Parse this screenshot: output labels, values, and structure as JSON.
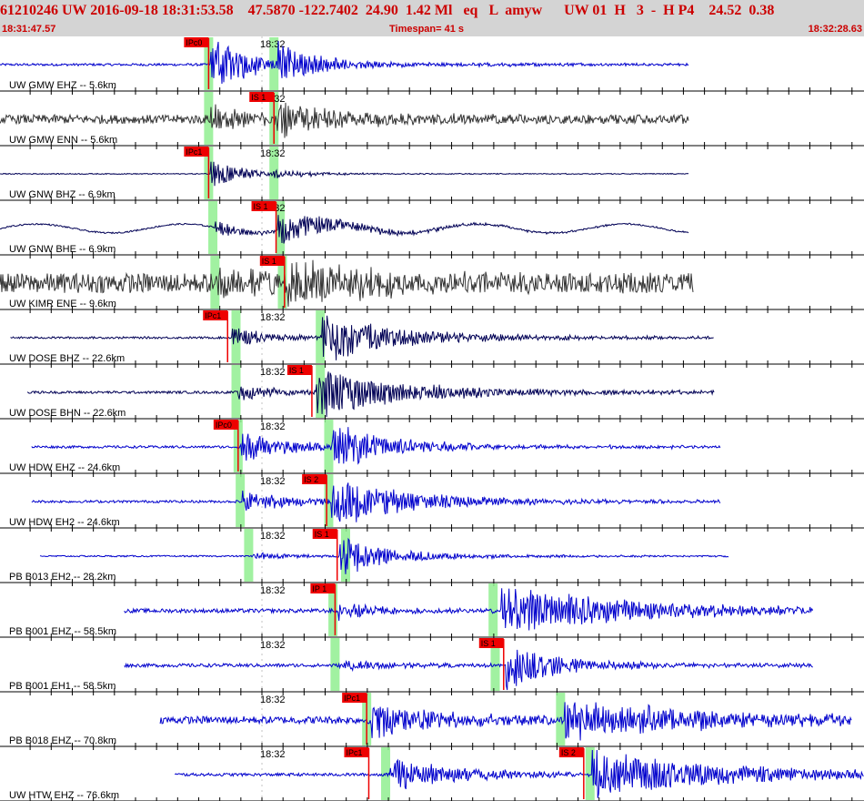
{
  "header": {
    "title": "61210246 UW 2016-09-18 18:31:53.58    47.5870 -122.7402  24.90  1.42 Ml   eq   L  amyw      UW 01  H   3  -  H P4    24.52  0.38",
    "start_time": "18:31:47.57",
    "timespan": "Timespan=  41 s",
    "end_time": "18:32:28.63"
  },
  "colors": {
    "grid": "#000000",
    "pick_box": "#ee0000",
    "pick_window": "#90ee90",
    "trace_blue": "#0000cc",
    "trace_dark": "#333333",
    "trace_navy": "#000055"
  },
  "chart_data": {
    "type": "line",
    "title": "61210246 UW 2016-09-18 18:31:53.58    47.5870 -122.7402  24.90  1.42 Ml   eq   L  amyw      UW 01  H   3  -  H P4    24.52  0.38",
    "x_start_time": "18:31:47.57",
    "x_end_time": "18:32:28.63",
    "timespan_s": 41,
    "minute_tick_label": "18:32",
    "minute_tick_offset_s": 12.43,
    "channels": [
      {
        "label": "UW GMW EHZ -- 5.6km",
        "color": "blue",
        "trace_start_s": 0.0,
        "trace_end_s": 32.7,
        "noise": 0.05,
        "picks": [
          {
            "label": "IPc0",
            "t": 9.9
          }
        ],
        "windows": [
          9.9,
          13.0
        ],
        "bursts": [
          {
            "t": 10.0,
            "amp": 1.0,
            "decay": 2.0
          },
          {
            "t": 13.2,
            "amp": 0.7,
            "decay": 1.5
          }
        ]
      },
      {
        "label": "UW GMW ENN -- 5.6km",
        "color": "dark",
        "trace_start_s": 0.0,
        "trace_end_s": 32.7,
        "noise": 0.18,
        "picks": [
          {
            "label": "IS 1",
            "t": 13.0
          }
        ],
        "windows": [
          9.9,
          13.0
        ],
        "bursts": [
          {
            "t": 10.0,
            "amp": 0.5,
            "decay": 2.0
          },
          {
            "t": 13.1,
            "amp": 0.85,
            "decay": 2.0
          }
        ]
      },
      {
        "label": "UW GNW BHZ -- 6.9km",
        "color": "navy",
        "trace_start_s": 0.0,
        "trace_end_s": 32.7,
        "noise": 0.02,
        "picks": [
          {
            "label": "IPc1",
            "t": 9.9
          }
        ],
        "windows": [
          9.9,
          13.0
        ],
        "bursts": [
          {
            "t": 10.0,
            "amp": 0.75,
            "decay": 1.0
          },
          {
            "t": 13.0,
            "amp": 0.15,
            "decay": 1.5
          }
        ]
      },
      {
        "label": "UW GNW BHE -- 6.9km",
        "color": "navy",
        "trace_start_s": 0.0,
        "trace_end_s": 32.7,
        "noise": 0.03,
        "picks": [
          {
            "label": "IS 1",
            "t": 13.1
          }
        ],
        "windows": [
          10.1,
          13.3
        ],
        "bursts": [
          {
            "t": 10.2,
            "amp": 0.3,
            "decay": 1.5
          },
          {
            "t": 13.2,
            "amp": 0.6,
            "decay": 2.5
          }
        ],
        "wave": 0.18
      },
      {
        "label": "UW KIMR ENE -- 9.6km",
        "color": "dark",
        "trace_start_s": 0.0,
        "trace_end_s": 32.9,
        "noise": 0.4,
        "picks": [
          {
            "label": "IS 1",
            "t": 13.5
          }
        ],
        "windows": [
          10.2,
          13.4
        ],
        "bursts": [
          {
            "t": 10.3,
            "amp": 0.5,
            "decay": 2.0
          },
          {
            "t": 13.6,
            "amp": 1.0,
            "decay": 3.0
          }
        ]
      },
      {
        "label": "UW DOSE BHZ -- 22.6km",
        "color": "navy",
        "trace_start_s": 0.5,
        "trace_end_s": 33.9,
        "noise": 0.04,
        "picks": [
          {
            "label": "IPc1",
            "t": 10.8
          }
        ],
        "windows": [
          11.2,
          15.2
        ],
        "bursts": [
          {
            "t": 11.0,
            "amp": 0.45,
            "decay": 1.5
          },
          {
            "t": 15.3,
            "amp": 1.0,
            "decay": 3.0
          }
        ]
      },
      {
        "label": "UW DOSE BHN -- 22.6km",
        "color": "navy",
        "trace_start_s": 1.3,
        "trace_end_s": 33.9,
        "noise": 0.05,
        "picks": [
          {
            "label": "IS 1",
            "t": 14.8
          }
        ],
        "windows": [
          11.2,
          15.2
        ],
        "bursts": [
          {
            "t": 11.3,
            "amp": 0.3,
            "decay": 2.0
          },
          {
            "t": 15.0,
            "amp": 1.0,
            "decay": 3.5
          }
        ]
      },
      {
        "label": "UW HDW EHZ -- 24.6km",
        "color": "blue",
        "trace_start_s": 1.5,
        "trace_end_s": 34.2,
        "noise": 0.05,
        "picks": [
          {
            "label": "IPc0",
            "t": 11.3
          }
        ],
        "windows": [
          11.3,
          15.6
        ],
        "bursts": [
          {
            "t": 11.4,
            "amp": 0.6,
            "decay": 2.0
          },
          {
            "t": 15.7,
            "amp": 0.9,
            "decay": 2.5
          }
        ]
      },
      {
        "label": "UW HDW EH2 -- 24.6km",
        "color": "blue",
        "trace_start_s": 1.5,
        "trace_end_s": 34.2,
        "noise": 0.05,
        "picks": [
          {
            "label": "IS 2",
            "t": 15.5
          }
        ],
        "windows": [
          11.4,
          15.6
        ],
        "bursts": [
          {
            "t": 11.5,
            "amp": 0.4,
            "decay": 2.5
          },
          {
            "t": 15.7,
            "amp": 1.0,
            "decay": 3.0
          }
        ]
      },
      {
        "label": "PB B013 EH2 -- 28.2km",
        "color": "blue",
        "trace_start_s": 1.9,
        "trace_end_s": 34.6,
        "noise": 0.03,
        "picks": [
          {
            "label": "IS 1",
            "t": 16.0
          }
        ],
        "windows": [
          11.8,
          16.4
        ],
        "bursts": [
          {
            "t": 12.0,
            "amp": 0.15,
            "decay": 2.0
          },
          {
            "t": 16.1,
            "amp": 0.8,
            "decay": 2.0
          }
        ]
      },
      {
        "label": "PB B001 EHZ -- 58.5km",
        "color": "blue",
        "trace_start_s": 5.9,
        "trace_end_s": 38.6,
        "noise": 0.08,
        "picks": [
          {
            "label": "IP 1",
            "t": 15.9
          }
        ],
        "windows": [
          15.8,
          23.4
        ],
        "bursts": [
          {
            "t": 16.0,
            "amp": 0.35,
            "decay": 2.0
          },
          {
            "t": 23.8,
            "amp": 1.0,
            "decay": 5.0
          }
        ]
      },
      {
        "label": "PB B001 EH1 -- 58.5km",
        "color": "blue",
        "trace_start_s": 5.9,
        "trace_end_s": 38.6,
        "noise": 0.07,
        "picks": [
          {
            "label": "IS 1",
            "t": 23.9
          }
        ],
        "windows": [
          15.9,
          23.5
        ],
        "bursts": [
          {
            "t": 16.1,
            "amp": 0.2,
            "decay": 2.0
          },
          {
            "t": 24.0,
            "amp": 1.0,
            "decay": 2.0
          }
        ]
      },
      {
        "label": "PB B018 EHZ -- 70.8km",
        "color": "blue",
        "trace_start_s": 7.6,
        "trace_end_s": 40.4,
        "noise": 0.15,
        "picks": [
          {
            "label": "IPc1",
            "t": 17.4
          }
        ],
        "windows": [
          17.4,
          26.6
        ],
        "bursts": [
          {
            "t": 17.6,
            "amp": 0.7,
            "decay": 3.0
          },
          {
            "t": 26.8,
            "amp": 0.8,
            "decay": 6.0
          }
        ]
      },
      {
        "label": "UW HTW EHZ -- 76.6km",
        "color": "blue",
        "trace_start_s": 8.3,
        "trace_end_s": 41.0,
        "noise": 0.06,
        "picks": [
          {
            "label": "IPc1",
            "t": 17.5
          },
          {
            "label": "IS 2",
            "t": 27.7
          }
        ],
        "windows": [
          18.3,
          28.0
        ],
        "bursts": [
          {
            "t": 18.5,
            "amp": 0.6,
            "decay": 3.0
          },
          {
            "t": 28.1,
            "amp": 1.0,
            "decay": 5.0
          }
        ]
      }
    ]
  }
}
